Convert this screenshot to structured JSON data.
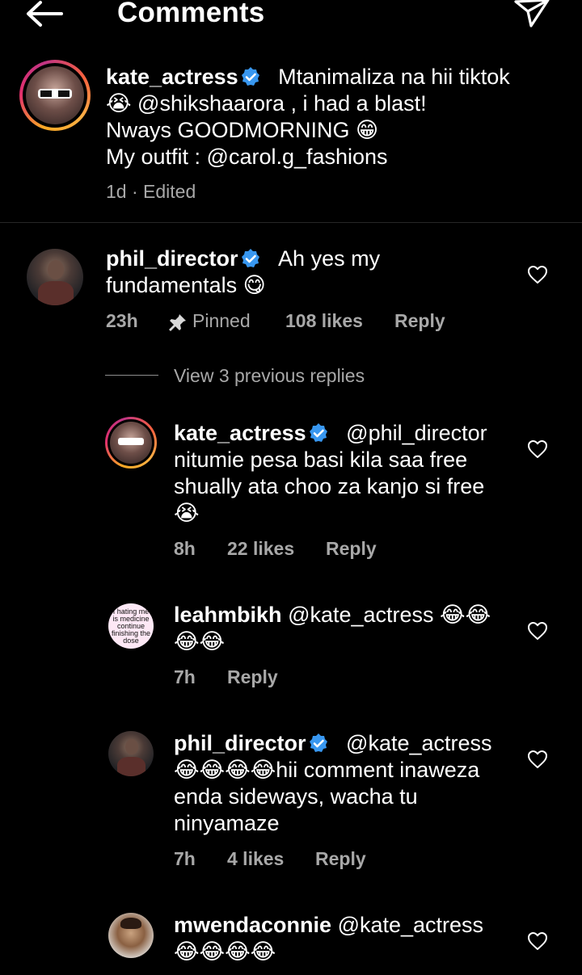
{
  "header": {
    "title": "Comments",
    "back_icon": "arrow-left-icon",
    "send_icon": "paper-plane-icon"
  },
  "caption": {
    "username": "kate_actress",
    "lines": [
      "Mtanimaliza na hii tiktok",
      "😭 @shikshaarora , i had a blast!",
      "Nways GOODMORNING 😁",
      "My outfit : @carol.g_fashions"
    ],
    "meta": "1d · Edited"
  },
  "comments": [
    {
      "username": "phil_director",
      "verified": true,
      "lines": [
        "Ah yes my",
        "fundamentals 😋"
      ],
      "time": "23h",
      "pinned_label": "Pinned",
      "likes": "108 likes",
      "reply": "Reply"
    }
  ],
  "view_replies": "View 3 previous replies",
  "replies": [
    {
      "username": "kate_actress",
      "verified": true,
      "lines": [
        "@phil_director",
        "nitumie pesa basi kila saa free",
        "shually ata choo za kanjo si free",
        "😭"
      ],
      "time": "8h",
      "likes": "22 likes",
      "reply": "Reply"
    },
    {
      "username": "leahmbikh",
      "verified": false,
      "avatar_text": "I hating me is medicine continue finishing the dose",
      "lines": [
        "@kate_actress 😂😂",
        "😂😂"
      ],
      "time": "7h",
      "reply": "Reply"
    },
    {
      "username": "phil_director",
      "verified": true,
      "lines": [
        "@kate_actress",
        "😂😂😂😂hii comment inaweza",
        "enda sideways, wacha tu",
        "ninyamaze"
      ],
      "time": "7h",
      "likes": "4 likes",
      "reply": "Reply"
    },
    {
      "username": "mwendaconnie",
      "verified": false,
      "lines": [
        "@kate_actress",
        "😂😂😂😂"
      ]
    }
  ],
  "colors": {
    "background": "#000000",
    "muted": "#a8a8a8",
    "verified": "#3897f0"
  }
}
